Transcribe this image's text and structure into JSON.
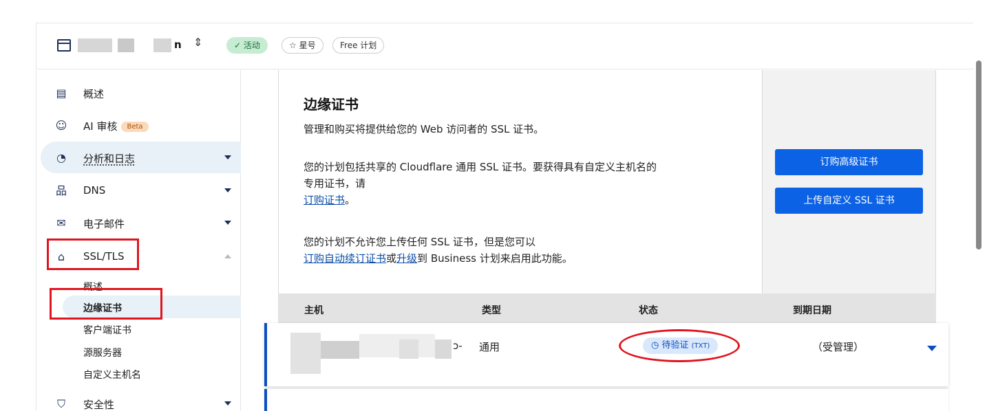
{
  "header": {
    "domain_suffix": "n",
    "site_switcher_icon": "chevron-up-down-icon",
    "badges": {
      "active": "✓ 活动",
      "star": "☆ 星号",
      "plan": "Free 计划"
    }
  },
  "sidebar": {
    "items": [
      {
        "label": "概述",
        "icon": "clipboard-icon"
      },
      {
        "label": "AI 审核",
        "icon": "ai-bot-icon",
        "badge": "Beta"
      },
      {
        "label": "分析和日志",
        "icon": "chart-pie-icon"
      },
      {
        "label": "DNS",
        "icon": "network-icon"
      },
      {
        "label": "电子邮件",
        "icon": "email-icon"
      },
      {
        "label": "SSL/TLS",
        "icon": "lock-icon"
      },
      {
        "label": "安全性",
        "icon": "shield-icon"
      }
    ],
    "ssl_sub": [
      "概述",
      "边缘证书",
      "客户端证书",
      "源服务器",
      "自定义主机名"
    ]
  },
  "card": {
    "title": "边缘证书",
    "desc": "管理和购买将提供给您的 Web 访问者的 SSL 证书。",
    "p1_text": "您的计划包括共享的 Cloudflare 通用 SSL 证书。要获得具有自定义主机名的",
    "p1_text2": "专用证书，请",
    "p1_link": "订购证书",
    "p1_end": "。",
    "p2_text": "您的计划不允许您上传任何 SSL 证书，但是您可以",
    "p2_link1": "订购自动续订证书",
    "p2_mid": "或",
    "p2_link2": "升级",
    "p2_end": "到 Business 计划来启用此功能。",
    "buttons": {
      "order_advanced": "订购高级证书",
      "upload_custom": "上传自定义 SSL 证书"
    }
  },
  "table": {
    "headers": [
      "主机",
      "类型",
      "状态",
      "到期日期"
    ],
    "row": {
      "host_visible": "ɔ-",
      "type": "通用",
      "status": "待验证",
      "status_suffix": "(TXT)",
      "expires": "（受管理）"
    }
  },
  "colors": {
    "accent": "#0b62e5",
    "highlight": "#e0141e",
    "active_badge": "#c6ecd2"
  }
}
